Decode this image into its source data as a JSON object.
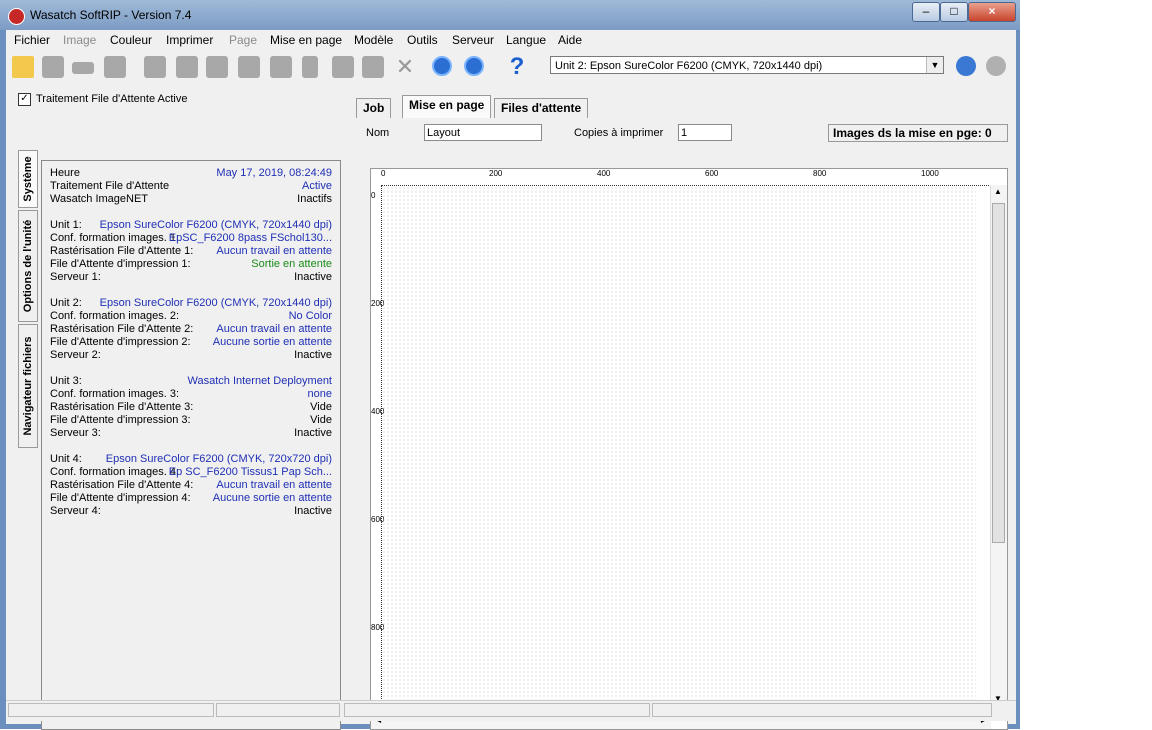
{
  "window": {
    "title": "Wasatch SoftRIP - Version 7.4"
  },
  "menu": [
    "Fichier",
    "Image",
    "Couleur",
    "Imprimer",
    "Page",
    "Mise en page",
    "Modèle",
    "Outils",
    "Serveur",
    "Langue",
    "Aide"
  ],
  "toolbar": {
    "unit_selected": "Unit 2: Epson  SureColor F6200  (CMYK, 720x1440 dpi)"
  },
  "left": {
    "queue_checkbox": "Traitement File d'Attente Active",
    "queue_checked": true,
    "vtabs": [
      "Système",
      "Options de l'unité",
      "Navigateur fichiers"
    ],
    "system": {
      "heure_label": "Heure",
      "heure_value": "May 17, 2019,  08:24:49",
      "traitement_label": "Traitement File d'Attente",
      "traitement_value": "Active",
      "imagenet_label": "Wasatch ImageNET",
      "imagenet_value": "Inactifs"
    },
    "units": [
      {
        "unit_label": "Unit 1:",
        "unit_value": "Epson  SureColor F6200  (CMYK, 720x1440 dpi)",
        "conf_label": "Conf. formation images. 1:",
        "conf_value": "EpSC_F6200 8pass FSchol130...",
        "rast_label": "Rastérisation File d'Attente 1:",
        "rast_value": "Aucun travail en attente",
        "print_label": "File d'Attente d'impression 1:",
        "print_value": "Sortie en attente",
        "serv_label": "Serveur 1:",
        "serv_value": "Inactive"
      },
      {
        "unit_label": "Unit 2:",
        "unit_value": "Epson  SureColor F6200  (CMYK, 720x1440 dpi)",
        "conf_label": "Conf. formation images. 2:",
        "conf_value": "No Color",
        "rast_label": "Rastérisation File d'Attente 2:",
        "rast_value": "Aucun travail en attente",
        "print_label": "File d'Attente d'impression 2:",
        "print_value": "Aucune sortie en attente",
        "serv_label": "Serveur 2:",
        "serv_value": "Inactive"
      },
      {
        "unit_label": "Unit 3:",
        "unit_value": "Wasatch  Internet Deployment",
        "conf_label": "Conf. formation images. 3:",
        "conf_value": "none",
        "rast_label": "Rastérisation File d'Attente 3:",
        "rast_value": "Vide",
        "print_label": "File d'Attente d'impression 3:",
        "print_value": "Vide",
        "serv_label": "Serveur 3:",
        "serv_value": "Inactive"
      },
      {
        "unit_label": "Unit 4:",
        "unit_value": "Epson  SureColor F6200  (CMYK, 720x720 dpi)",
        "conf_label": "Conf. formation images. 4:",
        "conf_value": "Ep SC_F6200 Tissus1 Pap Sch...",
        "rast_label": "Rastérisation File d'Attente 4:",
        "rast_value": "Aucun travail en attente",
        "print_label": "File d'Attente d'impression 4:",
        "print_value": "Aucune sortie en attente",
        "serv_label": "Serveur 4:",
        "serv_value": "Inactive"
      }
    ]
  },
  "right": {
    "tabs": [
      "Job",
      "Mise en page",
      "Files d'attente"
    ],
    "active_tab": "Mise en page",
    "nom_label": "Nom",
    "nom_value": "Layout",
    "copies_label": "Copies à imprimer",
    "copies_value": "1",
    "images_label": "Images ds la mise en pge: 0",
    "ruler_x": [
      "0",
      "200",
      "400",
      "600",
      "800",
      "1000"
    ],
    "ruler_y": [
      "0",
      "200",
      "400",
      "600",
      "800"
    ]
  }
}
